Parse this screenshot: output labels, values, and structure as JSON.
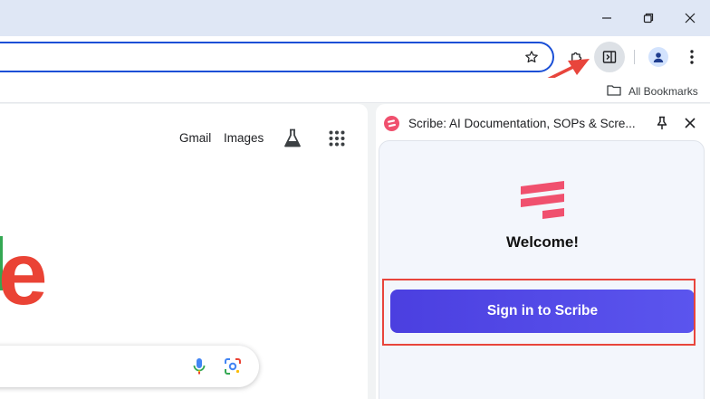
{
  "bookmarks_bar": {
    "all_bookmarks_label": "All Bookmarks"
  },
  "google_page": {
    "gmail_label": "Gmail",
    "images_label": "Images",
    "logo_partial": "e"
  },
  "side_panel": {
    "title": "Scribe: AI Documentation, SOPs & Scre...",
    "welcome_text": "Welcome!",
    "signin_label": "Sign in to Scribe"
  },
  "colors": {
    "accent": "#4b3fe0",
    "annotation": "#e8453c",
    "scribe_brand": "#f0506e",
    "omnibox_border": "#1a4fd6"
  },
  "icons": [
    "minimize-icon",
    "restore-icon",
    "close-icon",
    "star-icon",
    "extensions-icon",
    "side-panel-icon",
    "profile-icon",
    "more-menu-icon",
    "folder-icon",
    "labs-flask-icon",
    "apps-grid-icon",
    "mic-icon",
    "lens-icon",
    "scribe-logo-icon",
    "pin-icon",
    "panel-close-icon"
  ]
}
